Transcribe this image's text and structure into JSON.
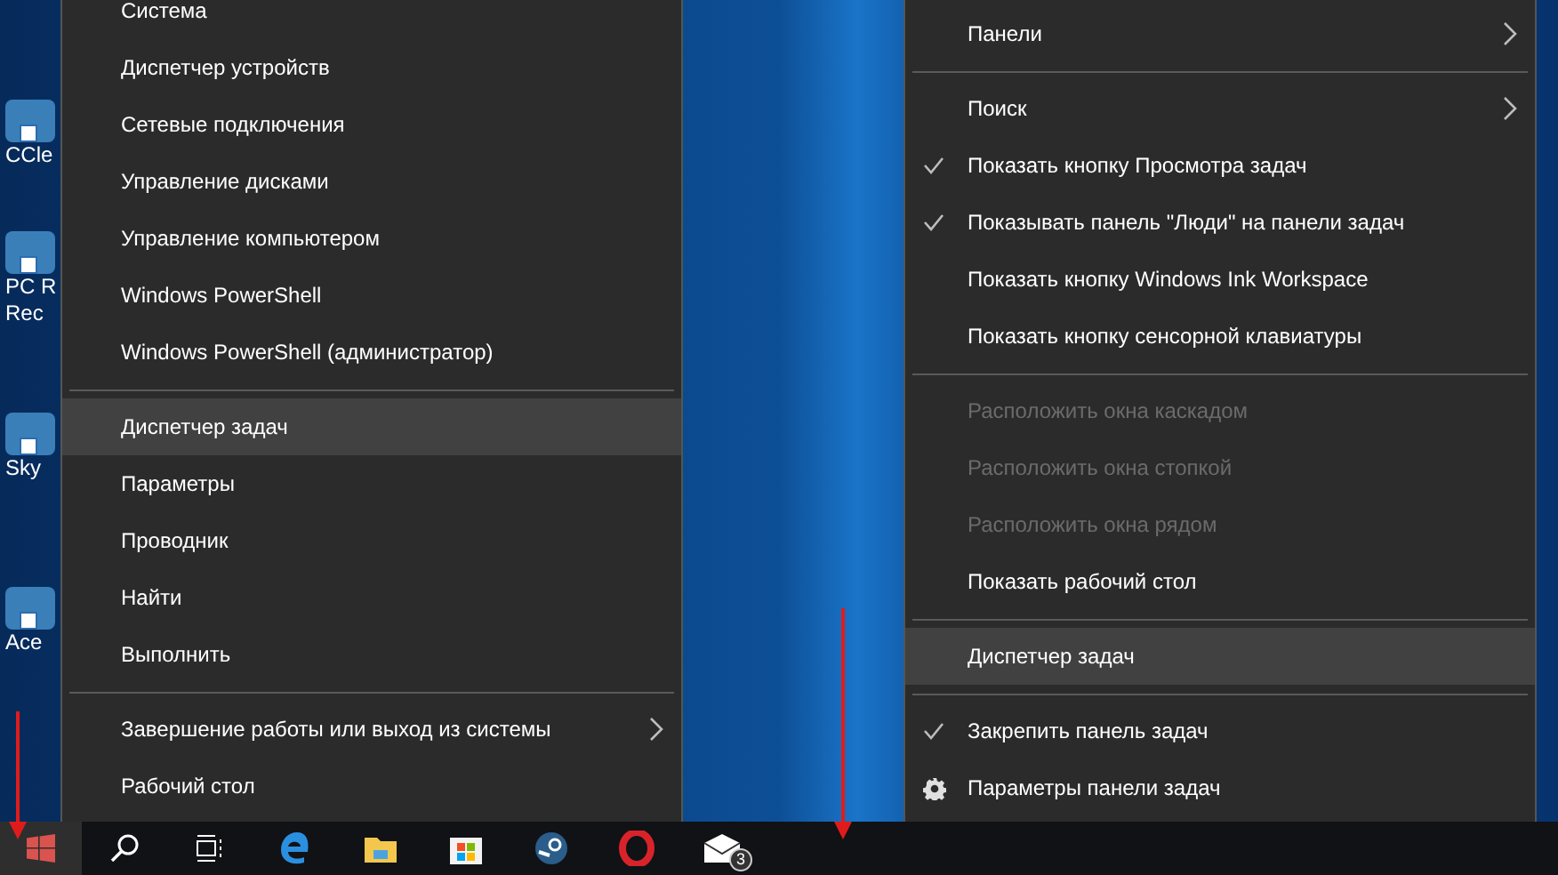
{
  "desktop_icons": [
    {
      "lines": [
        "CCle"
      ]
    },
    {
      "lines": [
        "PC R",
        "Rec"
      ]
    },
    {
      "lines": [
        "Sky"
      ]
    },
    {
      "lines": [
        "Ace"
      ]
    }
  ],
  "start_menu": {
    "items": [
      {
        "kind": "item",
        "label": "Система",
        "selected": false,
        "submenu": false
      },
      {
        "kind": "item",
        "label": "Диспетчер устройств",
        "selected": false,
        "submenu": false
      },
      {
        "kind": "item",
        "label": "Сетевые подключения",
        "selected": false,
        "submenu": false
      },
      {
        "kind": "item",
        "label": "Управление дисками",
        "selected": false,
        "submenu": false
      },
      {
        "kind": "item",
        "label": "Управление компьютером",
        "selected": false,
        "submenu": false
      },
      {
        "kind": "item",
        "label": "Windows PowerShell",
        "selected": false,
        "submenu": false
      },
      {
        "kind": "item",
        "label": "Windows PowerShell (администратор)",
        "selected": false,
        "submenu": false
      },
      {
        "kind": "separator"
      },
      {
        "kind": "item",
        "label": "Диспетчер задач",
        "selected": true,
        "submenu": false
      },
      {
        "kind": "item",
        "label": "Параметры",
        "selected": false,
        "submenu": false
      },
      {
        "kind": "item",
        "label": "Проводник",
        "selected": false,
        "submenu": false
      },
      {
        "kind": "item",
        "label": "Найти",
        "selected": false,
        "submenu": false
      },
      {
        "kind": "item",
        "label": "Выполнить",
        "selected": false,
        "submenu": false
      },
      {
        "kind": "separator"
      },
      {
        "kind": "item",
        "label": "Завершение работы или выход из системы",
        "selected": false,
        "submenu": true
      },
      {
        "kind": "item",
        "label": "Рабочий стол",
        "selected": false,
        "submenu": false
      }
    ]
  },
  "taskbar_menu": {
    "items": [
      {
        "kind": "item",
        "label": "Панели",
        "selected": false,
        "checked": false,
        "disabled": false,
        "submenu": true
      },
      {
        "kind": "separator"
      },
      {
        "kind": "item",
        "label": "Поиск",
        "selected": false,
        "checked": false,
        "disabled": false,
        "submenu": true
      },
      {
        "kind": "item",
        "label": "Показать кнопку Просмотра задач",
        "selected": false,
        "checked": true,
        "disabled": false,
        "submenu": false
      },
      {
        "kind": "item",
        "label": "Показывать панель \"Люди\" на панели задач",
        "selected": false,
        "checked": true,
        "disabled": false,
        "submenu": false
      },
      {
        "kind": "item",
        "label": "Показать кнопку Windows Ink Workspace",
        "selected": false,
        "checked": false,
        "disabled": false,
        "submenu": false
      },
      {
        "kind": "item",
        "label": "Показать кнопку сенсорной клавиатуры",
        "selected": false,
        "checked": false,
        "disabled": false,
        "submenu": false
      },
      {
        "kind": "separator"
      },
      {
        "kind": "item",
        "label": "Расположить окна каскадом",
        "selected": false,
        "checked": false,
        "disabled": true,
        "submenu": false
      },
      {
        "kind": "item",
        "label": "Расположить окна стопкой",
        "selected": false,
        "checked": false,
        "disabled": true,
        "submenu": false
      },
      {
        "kind": "item",
        "label": "Расположить окна рядом",
        "selected": false,
        "checked": false,
        "disabled": true,
        "submenu": false
      },
      {
        "kind": "item",
        "label": "Показать рабочий стол",
        "selected": false,
        "checked": false,
        "disabled": false,
        "submenu": false
      },
      {
        "kind": "separator"
      },
      {
        "kind": "item",
        "label": "Диспетчер задач",
        "selected": true,
        "checked": false,
        "disabled": false,
        "submenu": false
      },
      {
        "kind": "separator"
      },
      {
        "kind": "item",
        "label": "Закрепить панель задач",
        "selected": false,
        "checked": true,
        "disabled": false,
        "submenu": false
      },
      {
        "kind": "settings",
        "label": "Параметры панели задач",
        "selected": false,
        "disabled": false,
        "submenu": false
      }
    ]
  },
  "taskbar": {
    "start_selected": true,
    "mail_badge": "3"
  }
}
